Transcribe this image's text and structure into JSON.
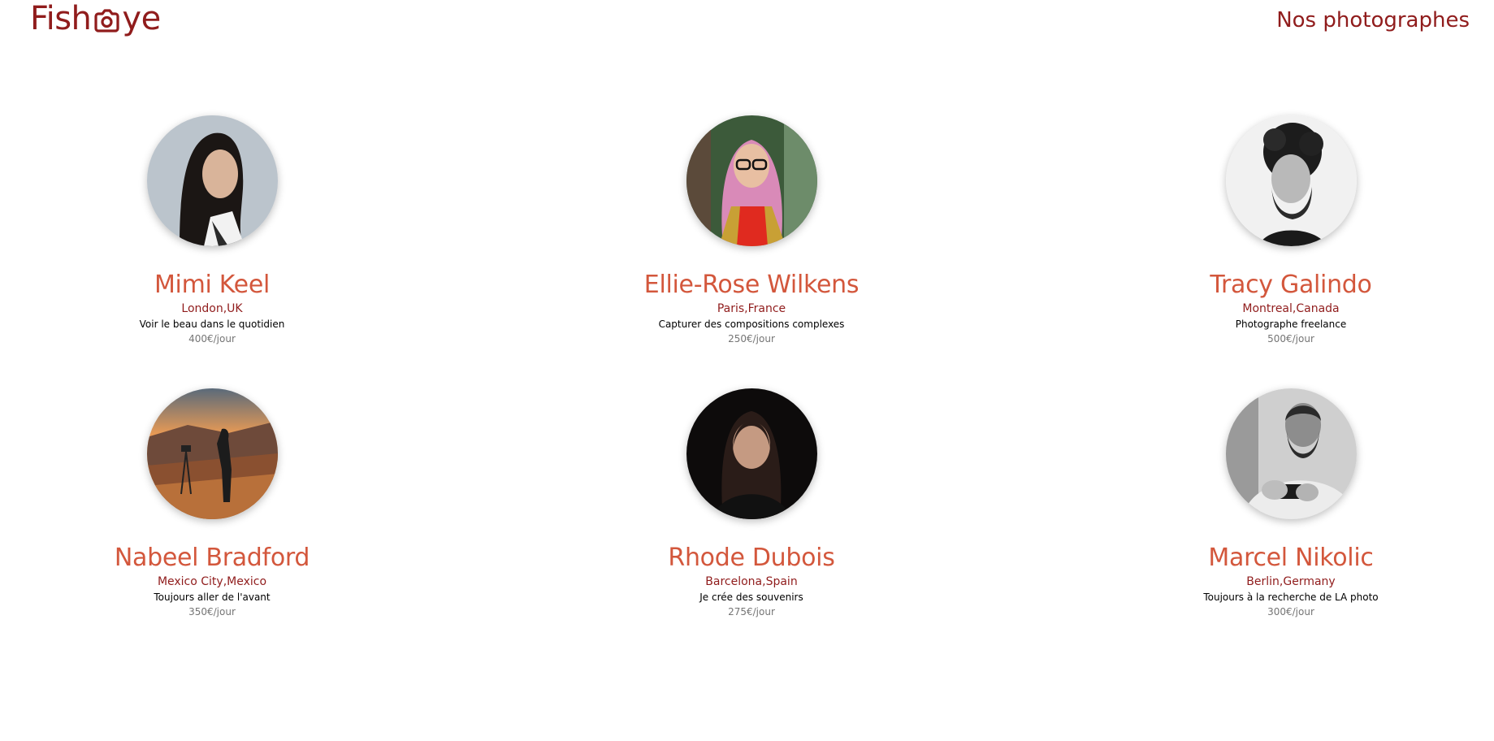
{
  "header": {
    "logo_prefix": "Fish",
    "logo_suffix": "ye",
    "page_heading": "Nos photographes"
  },
  "colors": {
    "primary": "#901C1C",
    "secondary": "#D3573C",
    "muted": "#757575"
  },
  "photographers": [
    {
      "name": "Mimi Keel",
      "location": "London,UK",
      "tagline": "Voir le beau dans le quotidien",
      "price": "400€/jour",
      "portrait": "woman-long-dark-hair-portrait"
    },
    {
      "name": "Ellie-Rose Wilkens",
      "location": "Paris,France",
      "tagline": "Capturer des compositions complexes",
      "price": "250€/jour",
      "portrait": "woman-pink-hair-glasses-portrait"
    },
    {
      "name": "Tracy Galindo",
      "location": "Montreal,Canada",
      "tagline": "Photographe freelance",
      "price": "500€/jour",
      "portrait": "man-curly-hair-beard-bw-portrait"
    },
    {
      "name": "Nabeel Bradford",
      "location": "Mexico City,Mexico",
      "tagline": "Toujours aller de l'avant",
      "price": "350€/jour",
      "portrait": "silhouette-sunset-tripod-portrait"
    },
    {
      "name": "Rhode Dubois",
      "location": "Barcelona,Spain",
      "tagline": "Je crée des souvenirs",
      "price": "275€/jour",
      "portrait": "woman-dark-background-portrait"
    },
    {
      "name": "Marcel Nikolic",
      "location": "Berlin,Germany",
      "tagline": "Toujours à la recherche de LA photo",
      "price": "300€/jour",
      "portrait": "man-beard-camera-bw-portrait"
    }
  ]
}
